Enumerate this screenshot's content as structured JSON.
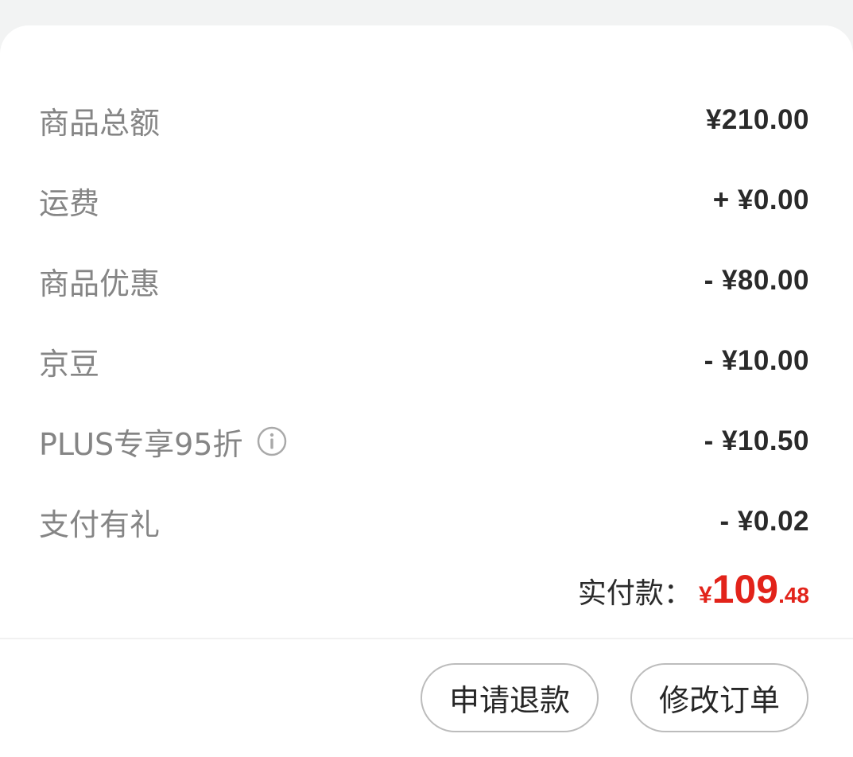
{
  "summary": {
    "items": [
      {
        "label": "商品总额",
        "value": "¥210.00"
      },
      {
        "label": "运费",
        "value": "+ ¥0.00"
      },
      {
        "label": "商品优惠",
        "value": "- ¥80.00"
      },
      {
        "label": "京豆",
        "value": "- ¥10.00"
      },
      {
        "label": "PLUS专享95折",
        "value": "- ¥10.50",
        "icon": "info-icon"
      },
      {
        "label": "支付有礼",
        "value": "- ¥0.02"
      }
    ],
    "total": {
      "label": "实付款：",
      "currency": "¥",
      "integer": "109",
      "decimal": ".48",
      "color": "#e2231a"
    }
  },
  "actions": {
    "refund_label": "申请退款",
    "modify_label": "修改订单"
  }
}
